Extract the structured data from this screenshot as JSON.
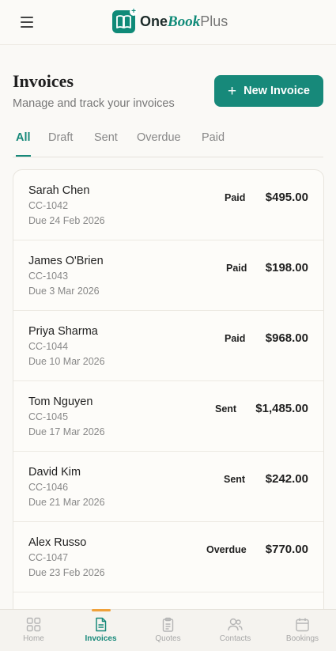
{
  "brand": {
    "name_one": "One",
    "name_book": "Book",
    "name_plus": "Plus",
    "logo_icon": "book-icon",
    "accent": "#0f8a78"
  },
  "header": {
    "menu_icon": "hamburger-menu-icon"
  },
  "page": {
    "title": "Invoices",
    "subtitle": "Manage and track your invoices",
    "new_button_label": "New Invoice"
  },
  "tabs": [
    {
      "label": "All",
      "active": true
    },
    {
      "label": "Draft",
      "active": false
    },
    {
      "label": "Sent",
      "active": false
    },
    {
      "label": "Overdue",
      "active": false
    },
    {
      "label": "Paid",
      "active": false
    }
  ],
  "invoices": [
    {
      "name": "Sarah Chen",
      "code": "CC-1042",
      "due": "Due 24 Feb 2026",
      "status": "Paid",
      "amount": "$495.00"
    },
    {
      "name": "James O'Brien",
      "code": "CC-1043",
      "due": "Due 3 Mar 2026",
      "status": "Paid",
      "amount": "$198.00"
    },
    {
      "name": "Priya Sharma",
      "code": "CC-1044",
      "due": "Due 10 Mar 2026",
      "status": "Paid",
      "amount": "$968.00"
    },
    {
      "name": "Tom Nguyen",
      "code": "CC-1045",
      "due": "Due 17 Mar 2026",
      "status": "Sent",
      "amount": "$1,485.00"
    },
    {
      "name": "David Kim",
      "code": "CC-1046",
      "due": "Due 21 Mar 2026",
      "status": "Sent",
      "amount": "$242.00"
    },
    {
      "name": "Alex Russo",
      "code": "CC-1047",
      "due": "Due 23 Feb 2026",
      "status": "Overdue",
      "amount": "$770.00"
    }
  ],
  "bottom_nav": [
    {
      "label": "Home",
      "icon": "grid-icon",
      "active": false
    },
    {
      "label": "Invoices",
      "icon": "document-icon",
      "active": true
    },
    {
      "label": "Quotes",
      "icon": "clipboard-icon",
      "active": false
    },
    {
      "label": "Contacts",
      "icon": "users-icon",
      "active": false
    },
    {
      "label": "Bookings",
      "icon": "calendar-icon",
      "active": false
    }
  ]
}
